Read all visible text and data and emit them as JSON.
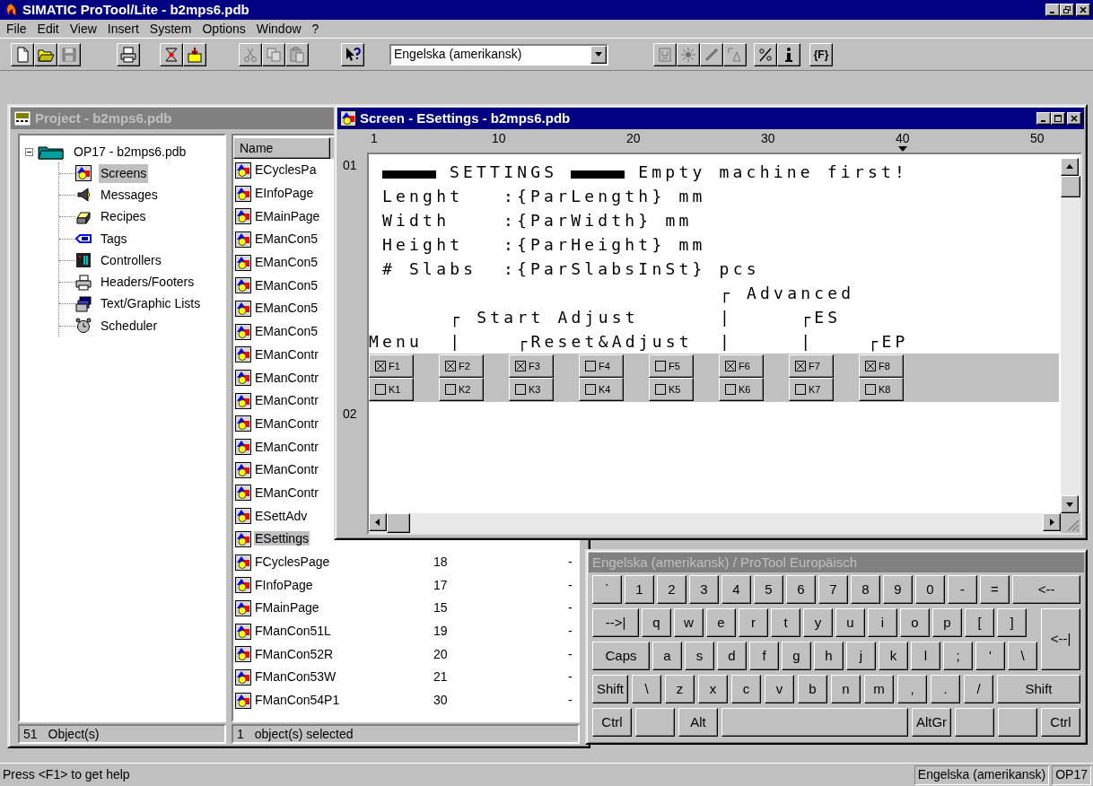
{
  "app": {
    "title": "SIMATIC ProTool/Lite - b2mps6.pdb"
  },
  "menu": [
    {
      "label": "File"
    },
    {
      "label": "Edit"
    },
    {
      "label": "View"
    },
    {
      "label": "Insert"
    },
    {
      "label": "System"
    },
    {
      "label": "Options"
    },
    {
      "label": "Window"
    },
    {
      "label": "?"
    }
  ],
  "toolbar": {
    "groups_before": [
      [
        {
          "disabled": false
        },
        {
          "disabled": false
        },
        {
          "disabled": true
        }
      ],
      [
        {
          "disabled": false
        }
      ],
      [
        {
          "disabled": false
        },
        {
          "disabled": false
        }
      ],
      [
        {
          "disabled": true
        },
        {
          "disabled": true
        },
        {
          "disabled": true
        }
      ],
      [
        {
          "disabled": false
        }
      ]
    ],
    "language": "Engelska (amerikansk)",
    "groups_after": [
      [
        {
          "disabled": true
        },
        {
          "disabled": true
        },
        {
          "disabled": true
        },
        {
          "disabled": true
        }
      ],
      [
        {
          "disabled": false
        },
        {
          "disabled": false
        }
      ],
      [
        {
          "label": "{F}",
          "disabled": false
        }
      ]
    ]
  },
  "project": {
    "title": "Project - b2mps6.pdb",
    "tree": {
      "label": "OP17 - b2mps6.pdb",
      "expanded": true,
      "children": [
        {
          "label": "Screens",
          "selected": true
        },
        {
          "label": "Messages",
          "selected": false
        },
        {
          "label": "Recipes",
          "selected": false
        },
        {
          "label": "Tags",
          "selected": false
        },
        {
          "label": "Controllers",
          "selected": false
        },
        {
          "label": "Headers/Footers",
          "selected": false
        },
        {
          "label": "Text/Graphic Lists",
          "selected": false
        },
        {
          "label": "Scheduler",
          "selected": false
        }
      ]
    },
    "list": {
      "columns": [
        "Name"
      ],
      "rows": [
        {
          "name": "ECyclesPa",
          "selected": false
        },
        {
          "name": "EInfoPage",
          "selected": false
        },
        {
          "name": "EMainPage",
          "selected": false
        },
        {
          "name": "EManCon5",
          "selected": false
        },
        {
          "name": "EManCon5",
          "selected": false
        },
        {
          "name": "EManCon5",
          "selected": false
        },
        {
          "name": "EManCon5",
          "selected": false
        },
        {
          "name": "EManCon5",
          "selected": false
        },
        {
          "name": "EManContr",
          "selected": false
        },
        {
          "name": "EManContr",
          "selected": false
        },
        {
          "name": "EManContr",
          "selected": false
        },
        {
          "name": "EManContr",
          "selected": false
        },
        {
          "name": "EManContr",
          "selected": false
        },
        {
          "name": "EManContr",
          "selected": false
        },
        {
          "name": "EManContr",
          "selected": false
        },
        {
          "name": "ESettAdv",
          "selected": false
        },
        {
          "name": "ESettings",
          "selected": true
        },
        {
          "name": "FCyclesPage",
          "column_2": "18",
          "column_3": "-",
          "selected": false
        },
        {
          "name": "FInfoPage",
          "column_2": "17",
          "column_3": "-",
          "selected": false
        },
        {
          "name": "FMainPage",
          "column_2": "15",
          "column_3": "-",
          "selected": false
        },
        {
          "name": "FManCon51L",
          "column_2": "19",
          "column_3": "-",
          "selected": false
        },
        {
          "name": "FManCon52R",
          "column_2": "20",
          "column_3": "-",
          "selected": false
        },
        {
          "name": "FManCon53W",
          "column_2": "21",
          "column_3": "-",
          "selected": false
        },
        {
          "name": "FManCon54P1",
          "column_2": "30",
          "column_3": "-",
          "selected": false
        }
      ]
    },
    "status_left": {
      "count": "51",
      "text": "Object(s)"
    },
    "status_right": {
      "count": "1",
      "text": "object(s) selected"
    }
  },
  "screen": {
    "title": "Screen - ESettings - b2mps6.pdb",
    "ruler": [
      "1",
      "10",
      "20",
      "30",
      "40",
      "50"
    ],
    "row_labels": [
      "01",
      "02"
    ],
    "heading": {
      "title": "SETTINGS",
      "note": "Empty machine first!"
    },
    "fields": [
      {
        "label": "Lenght",
        "value": ":{ParLength} mm"
      },
      {
        "label": "Width",
        "value": ":{ParWidth} mm"
      },
      {
        "label": "Height",
        "value": ":{ParHeight} mm"
      },
      {
        "label": "# Slabs",
        "value": ":{ParSlabsInSt} pcs"
      }
    ],
    "annotations": [
      "                          ┌ Advanced",
      "      ┌ Start Adjust      |     ┌ES",
      "Menu  |    ┌Reset&Adjust  |     |    ┌EP"
    ],
    "function_keys": [
      {
        "f": {
          "label": "F1",
          "checked": true
        },
        "k": {
          "label": "K1",
          "checked": false
        }
      },
      {
        "f": {
          "label": "F2",
          "checked": true
        },
        "k": {
          "label": "K2",
          "checked": false
        }
      },
      {
        "f": {
          "label": "F3",
          "checked": true
        },
        "k": {
          "label": "K3",
          "checked": false
        }
      },
      {
        "f": {
          "label": "F4",
          "checked": false
        },
        "k": {
          "label": "K4",
          "checked": false
        }
      },
      {
        "f": {
          "label": "F5",
          "checked": false
        },
        "k": {
          "label": "K5",
          "checked": false
        }
      },
      {
        "f": {
          "label": "F6",
          "checked": true
        },
        "k": {
          "label": "K6",
          "checked": false
        }
      },
      {
        "f": {
          "label": "F7",
          "checked": true
        },
        "k": {
          "label": "K7",
          "checked": false
        }
      },
      {
        "f": {
          "label": "F8",
          "checked": true
        },
        "k": {
          "label": "K8",
          "checked": false
        }
      }
    ]
  },
  "keyboard": {
    "title": "Engelska (amerikansk) / ProTool Europäisch",
    "rows": [
      [
        {
          "label": "`",
          "kind": "key"
        },
        {
          "label": "1",
          "kind": "key"
        },
        {
          "label": "2",
          "kind": "key"
        },
        {
          "label": "3",
          "kind": "key"
        },
        {
          "label": "4",
          "kind": "key"
        },
        {
          "label": "5",
          "kind": "key"
        },
        {
          "label": "6",
          "kind": "key"
        },
        {
          "label": "7",
          "kind": "key"
        },
        {
          "label": "8",
          "kind": "key"
        },
        {
          "label": "9",
          "kind": "key"
        },
        {
          "label": "0",
          "kind": "key"
        },
        {
          "label": "-",
          "kind": "key"
        },
        {
          "label": "=",
          "kind": "key"
        },
        {
          "label": "<--",
          "kind": "backspace"
        }
      ],
      [
        {
          "label": "-->|",
          "kind": "tab"
        },
        {
          "label": "q",
          "kind": "key"
        },
        {
          "label": "w",
          "kind": "key"
        },
        {
          "label": "e",
          "kind": "key"
        },
        {
          "label": "r",
          "kind": "key"
        },
        {
          "label": "t",
          "kind": "key"
        },
        {
          "label": "y",
          "kind": "key"
        },
        {
          "label": "u",
          "kind": "key"
        },
        {
          "label": "i",
          "kind": "key"
        },
        {
          "label": "o",
          "kind": "key"
        },
        {
          "label": "p",
          "kind": "key"
        },
        {
          "label": "[",
          "kind": "key"
        },
        {
          "label": "]",
          "kind": "key"
        },
        {
          "label": "<--|",
          "kind": "enter"
        }
      ],
      [
        {
          "label": "Caps",
          "kind": "caps"
        },
        {
          "label": "a",
          "kind": "key"
        },
        {
          "label": "s",
          "kind": "key"
        },
        {
          "label": "d",
          "kind": "key"
        },
        {
          "label": "f",
          "kind": "key"
        },
        {
          "label": "g",
          "kind": "key"
        },
        {
          "label": "h",
          "kind": "key"
        },
        {
          "label": "j",
          "kind": "key"
        },
        {
          "label": "k",
          "kind": "key"
        },
        {
          "label": "l",
          "kind": "key"
        },
        {
          "label": ";",
          "kind": "key"
        },
        {
          "label": "'",
          "kind": "key"
        },
        {
          "label": "\\",
          "kind": "key"
        }
      ],
      [
        {
          "label": "Shift",
          "kind": "shift"
        },
        {
          "label": "\\",
          "kind": "key"
        },
        {
          "label": "z",
          "kind": "key"
        },
        {
          "label": "x",
          "kind": "key"
        },
        {
          "label": "c",
          "kind": "key"
        },
        {
          "label": "v",
          "kind": "key"
        },
        {
          "label": "b",
          "kind": "key"
        },
        {
          "label": "n",
          "kind": "key"
        },
        {
          "label": "m",
          "kind": "key"
        },
        {
          "label": ",",
          "kind": "key"
        },
        {
          "label": ".",
          "kind": "key"
        },
        {
          "label": "/",
          "kind": "key"
        },
        {
          "label": "Shift",
          "kind": "rshift"
        }
      ],
      [
        {
          "label": "Ctrl",
          "kind": "mod"
        },
        {
          "kind": "blank"
        },
        {
          "label": "Alt",
          "kind": "mod"
        },
        {
          "kind": "space"
        },
        {
          "label": "AltGr",
          "kind": "mod"
        },
        {
          "kind": "blank"
        },
        {
          "kind": "blank"
        },
        {
          "label": "Ctrl",
          "kind": "mod"
        }
      ]
    ]
  },
  "status_bar": {
    "help": "Press <F1> to get help",
    "language": "Engelska (amerikansk)",
    "device": "OP17"
  }
}
